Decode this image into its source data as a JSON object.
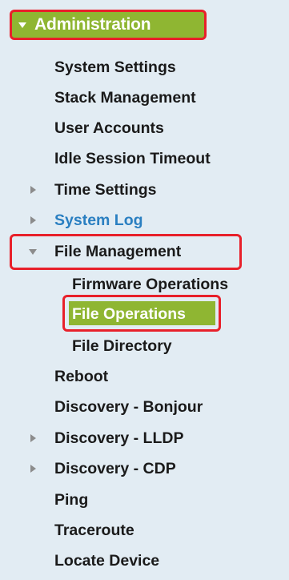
{
  "sidebar": {
    "section_title": "Administration",
    "items": {
      "system_settings": "System Settings",
      "stack_management": "Stack Management",
      "user_accounts": "User Accounts",
      "idle_session_timeout": "Idle Session Timeout",
      "time_settings": "Time Settings",
      "system_log": "System Log",
      "file_management": "File Management",
      "firmware_operations": "Firmware Operations",
      "file_operations": "File Operations",
      "file_directory": "File Directory",
      "reboot": "Reboot",
      "discovery_bonjour": "Discovery - Bonjour",
      "discovery_lldp": "Discovery - LLDP",
      "discovery_cdp": "Discovery - CDP",
      "ping": "Ping",
      "traceroute": "Traceroute",
      "locate_device": "Locate Device"
    }
  },
  "colors": {
    "accent_green": "#8fb632",
    "highlight_red": "#e8202a",
    "link_blue": "#2a7fc1",
    "background": "#e2ecf3"
  },
  "selected_item": "File Operations"
}
